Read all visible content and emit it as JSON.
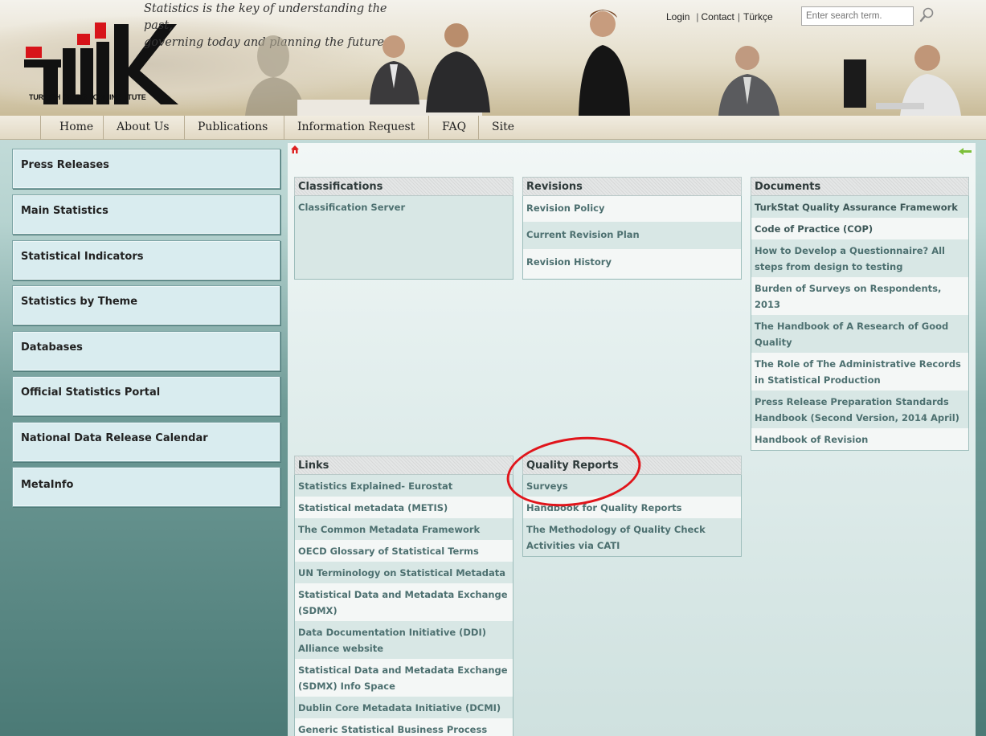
{
  "header": {
    "logo_text": "TÜİK",
    "logo_subtitle": "TURKISH STATISTICAL INSTITUTE",
    "slogan_line1": "Statistics is the key of understanding the past,",
    "slogan_line2": "governing today and planning the future",
    "login": "Login",
    "contact": "Contact",
    "language": "Türkçe",
    "search_placeholder": "Enter search term."
  },
  "nav": {
    "items": [
      "Home",
      "About Us",
      "Publications",
      "Information Request",
      "FAQ",
      "Site Map"
    ]
  },
  "sidebar": {
    "items": [
      "Press Releases",
      "Main Statistics",
      "Statistical Indicators",
      "Statistics by Theme",
      "Databases",
      "Official Statistics Portal",
      "National Data Release Calendar",
      "MetaInfo"
    ]
  },
  "panels": {
    "classifications": {
      "title": "Classifications",
      "items": [
        "Classification Server"
      ]
    },
    "revisions": {
      "title": "Revisions",
      "items": [
        "Revision Policy",
        "Current Revision Plan",
        "Revision History"
      ]
    },
    "documents": {
      "title": "Documents",
      "items": [
        "TurkStat Quality Assurance Framework",
        "Code of Practice (COP)",
        "How to Develop a Questionnaire? All steps from design to testing",
        "Burden of Surveys on Respondents, 2013",
        "The Handbook of A Research of Good Quality",
        "The Role of The Administrative Records in Statistical Production",
        "Press Release Preparation Standards Handbook (Second Version, 2014 April)",
        "Handbook of Revision"
      ]
    },
    "links": {
      "title": "Links",
      "items": [
        "Statistics Explained- Eurostat",
        "Statistical metadata (METIS)",
        "The Common Metadata Framework",
        "OECD Glossary of Statistical Terms",
        "UN Terminology on Statistical Metadata",
        "Statistical Data and Metadata Exchange (SDMX)",
        "Data Documentation Initiative (DDI) Alliance website",
        "Statistical Data and Metadata Exchange (SDMX) Info Space",
        "Dublin Core Metadata Initiative (DCMI)",
        "Generic Statistical Business Process"
      ]
    },
    "quality_reports": {
      "title": "Quality Reports",
      "items": [
        "Surveys",
        "Handbook for Quality Reports",
        "The Methodology of Quality Check Activities via CATI"
      ]
    }
  },
  "colors": {
    "highlight_oval": "#e0151b",
    "logo_red": "#d7141a",
    "logo_black": "#111111"
  }
}
